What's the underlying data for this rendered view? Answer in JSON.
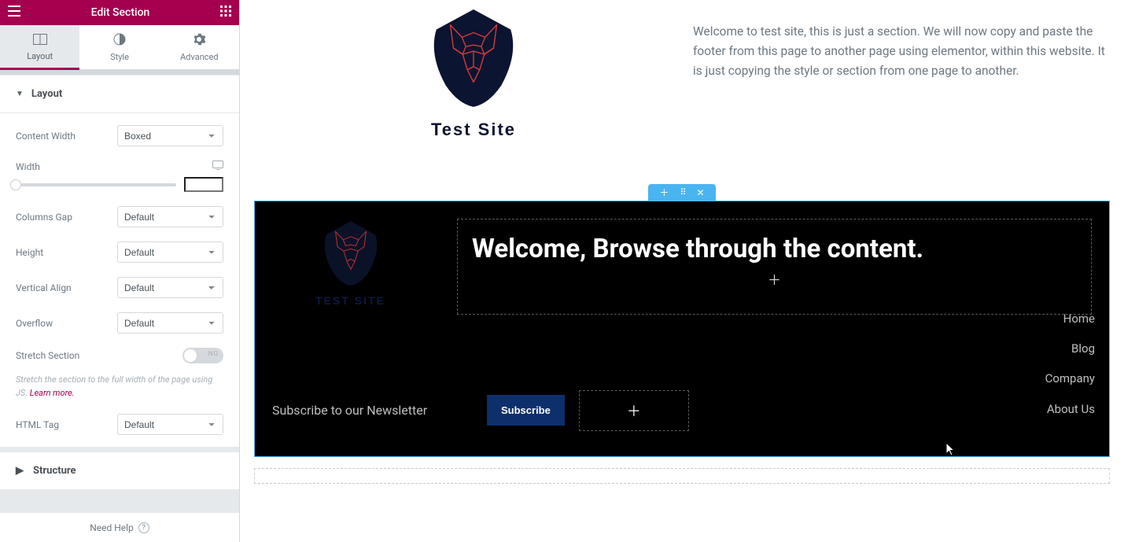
{
  "panel": {
    "title": "Edit Section",
    "tabs": {
      "layout": "Layout",
      "style": "Style",
      "advanced": "Advanced"
    },
    "sections": {
      "layout": "Layout",
      "structure": "Structure"
    },
    "fields": {
      "content_width": {
        "label": "Content Width",
        "value": "Boxed"
      },
      "width": {
        "label": "Width",
        "value": ""
      },
      "columns_gap": {
        "label": "Columns Gap",
        "value": "Default"
      },
      "height": {
        "label": "Height",
        "value": "Default"
      },
      "vertical_align": {
        "label": "Vertical Align",
        "value": "Default"
      },
      "overflow": {
        "label": "Overflow",
        "value": "Default"
      },
      "stretch": {
        "label": "Stretch Section",
        "off_text": "NO"
      },
      "stretch_help": "Stretch the section to the full width of the page using JS. ",
      "stretch_learn": "Learn more.",
      "html_tag": {
        "label": "HTML Tag",
        "value": "Default"
      }
    },
    "footer": {
      "help": "Need Help"
    }
  },
  "hero": {
    "brand": "Test Site",
    "paragraph": "Welcome to test site, this is just a section. We will now copy and paste the footer from this page to another page using elementor, within this website. It is just copying the style or section from one page to another."
  },
  "footer": {
    "brand_small": "TEST SITE",
    "welcome": "Welcome, Browse through the content.",
    "nav": [
      "Home",
      "Blog",
      "Company",
      "About Us"
    ],
    "newsletter": "Subscribe to our Newsletter",
    "subscribe": "Subscribe"
  }
}
